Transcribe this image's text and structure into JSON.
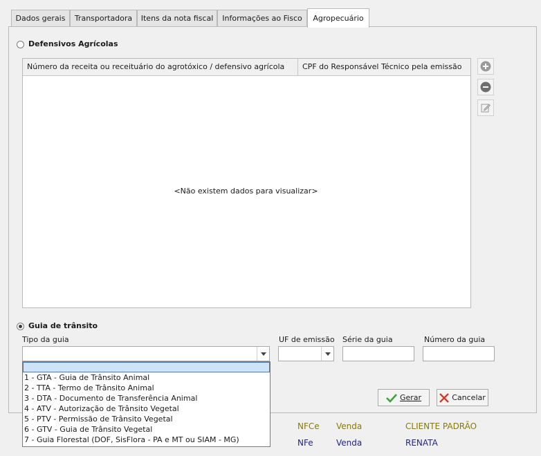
{
  "tabs": [
    {
      "label": "Dados gerais",
      "active": false
    },
    {
      "label": "Transportadora",
      "active": false
    },
    {
      "label": "Itens da nota fiscal",
      "active": false
    },
    {
      "label": "Informações ao Fisco",
      "active": false
    },
    {
      "label": "Agropecuário",
      "active": true
    }
  ],
  "defensivos": {
    "label": "Defensivos Agrícolas",
    "selected": false,
    "columns": [
      "Número da receita ou receituário do agrotóxico / defensivo agrícola",
      "CPF do Responsável Técnico pela emissão"
    ],
    "empty_message": "<Não existem dados para visualizar>",
    "actions": [
      "add-icon",
      "remove-icon",
      "edit-icon"
    ]
  },
  "guia": {
    "label": "Guia de trânsito",
    "selected": true,
    "tipo_label": "Tipo da guia",
    "tipo_value": "",
    "uf_label": "UF de emissão",
    "uf_value": "",
    "serie_label": "Série da guia",
    "serie_value": "",
    "numero_label": "Número da guia",
    "numero_value": "",
    "options": [
      "",
      "1 - GTA - Guia de Trânsito Animal",
      "2 - TTA - Termo de Trânsito Animal",
      "3 - DTA - Documento de Transferência Animal",
      "4 - ATV - Autorização de Trânsito Vegetal",
      "5 - PTV - Permissão de Trânsito Vegetal",
      "6 - GTV - Guia de Trânsito Vegetal",
      "7 - Guia Florestal (DOF, SisFlora - PA e MT ou SIAM - MG)"
    ]
  },
  "buttons": {
    "gerar": "Gerar",
    "cancelar": "Cancelar"
  },
  "background_rows": [
    {
      "tipo": "NFCe",
      "operacao": "Venda",
      "cliente": "CLIENTE PADRÃO"
    },
    {
      "tipo": "NFe",
      "operacao": "Venda",
      "cliente": "RENATA"
    }
  ],
  "colors": {
    "row1_text": "#8a7a00",
    "row2_text": "#1f1f8f",
    "gerar_check": "#3aa33a",
    "cancelar_x": "#d23b2a"
  }
}
